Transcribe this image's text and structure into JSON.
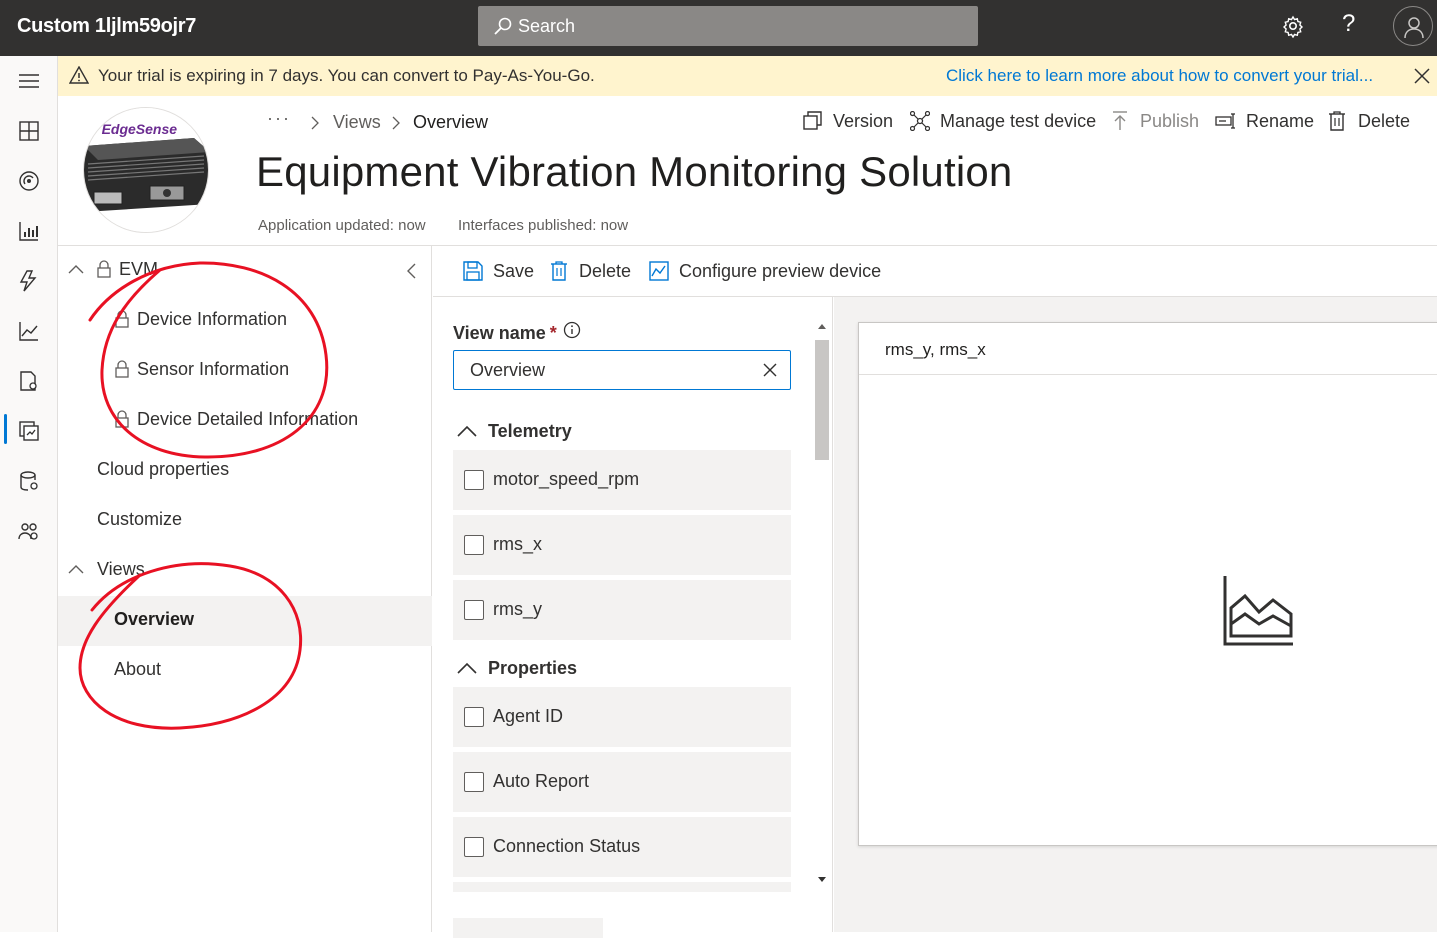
{
  "app": {
    "title": "Custom 1ljlm59ojr7"
  },
  "search": {
    "placeholder": "Search"
  },
  "topbar": {
    "help": "?"
  },
  "banner": {
    "message": "Your trial is expiring in 7 days. You can convert to Pay-As-You-Go.",
    "link": "Click here to learn more about how to convert your trial..."
  },
  "breadcrumb": {
    "ellipsis": "···",
    "views": "Views",
    "current": "Overview"
  },
  "header": {
    "title": "Equipment Vibration Monitoring Solution",
    "app_updated": "Application updated: now",
    "interfaces_published": "Interfaces published: now",
    "logo_text": "s/ EdgeSense"
  },
  "commands": {
    "version": "Version",
    "manage_test_device": "Manage test device",
    "publish": "Publish",
    "rename": "Rename",
    "delete": "Delete"
  },
  "tree": {
    "root": "EVM",
    "interfaces": [
      "Device Information",
      "Sensor Information",
      "Device Detailed Information"
    ],
    "cloud_properties": "Cloud properties",
    "customize": "Customize",
    "views": "Views",
    "view_items": [
      "Overview",
      "About"
    ]
  },
  "editor": {
    "save": "Save",
    "delete": "Delete",
    "configure_preview": "Configure preview device",
    "view_name_label": "View name",
    "required_marker": "*",
    "view_name_value": "Overview",
    "telemetry_heading": "Telemetry",
    "telemetry": [
      "motor_speed_rpm",
      "rms_x",
      "rms_y"
    ],
    "properties_heading": "Properties",
    "properties": [
      "Agent ID",
      "Auto Report",
      "Connection Status"
    ]
  },
  "tile": {
    "title": "rms_y, rms_x"
  },
  "colors": {
    "accent": "#0078d4",
    "topbar": "#323130",
    "banner": "#fff4ce",
    "annotation": "#e81123"
  }
}
